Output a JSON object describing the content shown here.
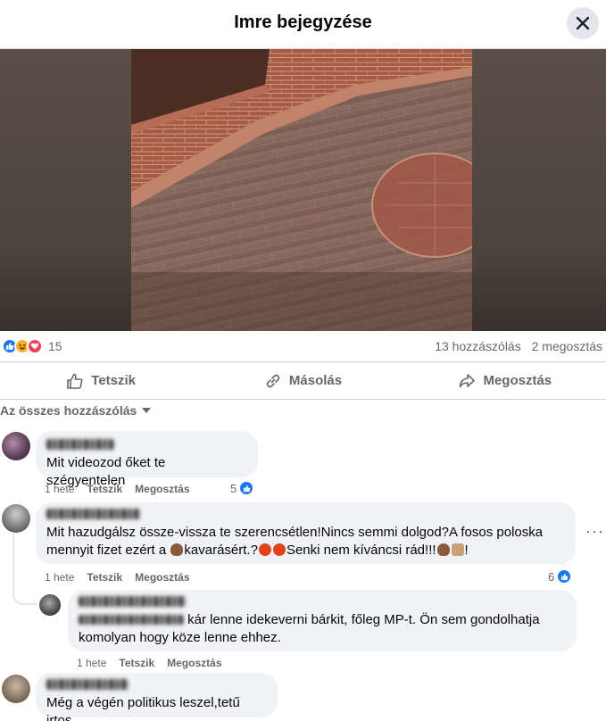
{
  "header": {
    "title": "Imre bejegyzése"
  },
  "stats": {
    "reaction_count": "15",
    "comments": "13 hozzászólás",
    "shares": "2 megosztás"
  },
  "actions": {
    "like": "Tetszik",
    "copy": "Másolás",
    "share": "Megosztás"
  },
  "sort": {
    "label": "Az összes hozzászólás"
  },
  "comments": [
    {
      "text": "Mit videozod őket te szégyentelen",
      "time": "1 hete",
      "like": "Tetszik",
      "share": "Megosztás",
      "likes": "5"
    },
    {
      "line1": "Mit hazudgálsz össze-vissza te szerencsétlen!Nincs semmi dolgod?A fosos poloska",
      "line2a": "mennyit fizet ezért a ",
      "line2b": "kavarásért.?",
      "line2c": "Senki nem kíváncsi rád!!!",
      "line2d": "!",
      "time": "1 hete",
      "like": "Tetszik",
      "share": "Megosztás",
      "likes": "6",
      "more": "···"
    },
    {
      "line1": "kár lenne idekeverni bárkit, főleg MP-t. Ön sem gondolhatja",
      "line2": "komolyan hogy köze lenne ehhez.",
      "time": "1 hete",
      "like": "Tetszik",
      "share": "Megosztás"
    },
    {
      "text": "Még a végén politikus leszel,tetű irtos"
    }
  ],
  "colors": {
    "accent": "#1877f2",
    "bubble": "#f0f2f5",
    "muted": "#65676b"
  }
}
